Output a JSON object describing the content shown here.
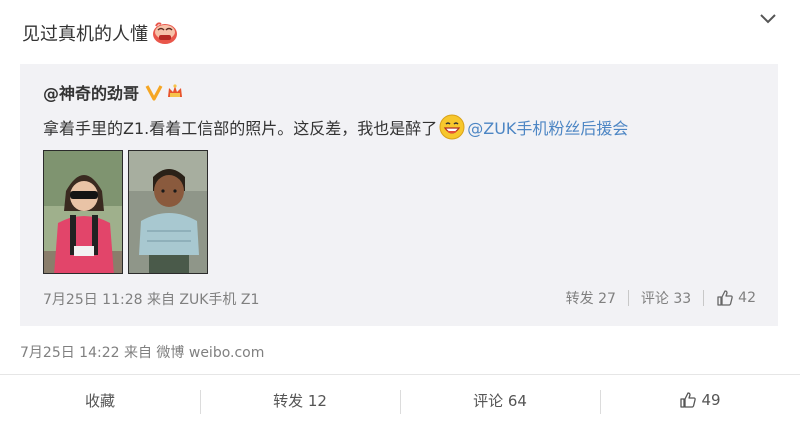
{
  "post": {
    "text": "见过真机的人懂",
    "emoji_icon": "blush-face-icon",
    "meta": "7月25日 14:22 来自 微博 weibo.com"
  },
  "repost": {
    "author": "@神奇的劲哥",
    "text": "拿着手里的Z1.看着工信部的照片。这反差，我也是醉了",
    "mention": "@ZUK手机粉丝后援会",
    "meta": "7月25日 11:28 来自 ZUK手机 Z1",
    "actions": {
      "forward": "转发 27",
      "comment": "评论 33",
      "like": "42"
    },
    "images": [
      "photo-child-sunglasses",
      "photo-child-sweater"
    ]
  },
  "bottom_bar": {
    "favorite": "收藏",
    "forward": "转发 12",
    "comment": "评论 64",
    "like": "49"
  },
  "colors": {
    "link": "#4d86c4",
    "meta_gray": "#808080",
    "repost_bg": "#f2f2f5",
    "v_badge": "#f5a623"
  }
}
